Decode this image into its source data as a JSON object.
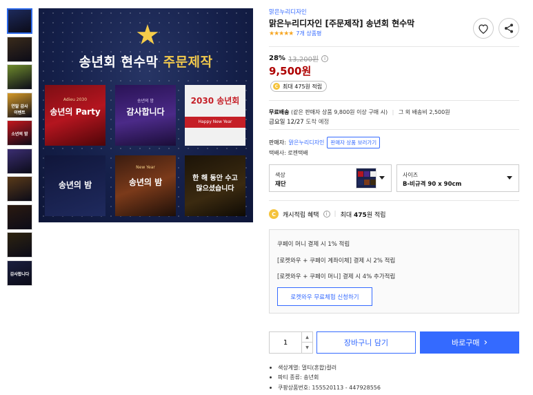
{
  "thumbnails": [
    {
      "label": "",
      "color": "#1d2a5c",
      "active": true
    },
    {
      "label": "",
      "color": "#3a2b1a"
    },
    {
      "label": "",
      "color": "#6e8a2c"
    },
    {
      "label": "연말 감사 이벤트",
      "color": "#d59a28"
    },
    {
      "label": "소년의 밤",
      "color": "#c4161c"
    },
    {
      "label": "",
      "color": "#3b2e72"
    },
    {
      "label": "",
      "color": "#5a3a18"
    },
    {
      "label": "",
      "color": "#2b1a10"
    },
    {
      "label": "",
      "color": "#2e2410"
    },
    {
      "label": "감사합니다",
      "color": "#1b1f3e"
    }
  ],
  "main_image": {
    "headline_a": "송년회 현수막",
    "headline_b": "주문제작",
    "tiles": [
      {
        "title": "송년의 Party",
        "sub": "Adieu 2030"
      },
      {
        "title": "감사합니다",
        "sub": "송년의 밤"
      },
      {
        "title": "2030 송년회",
        "sub": "Happy New Year"
      },
      {
        "title": "송년의 밤",
        "sub": ""
      },
      {
        "title": "송년의 밤",
        "sub": "New Year"
      },
      {
        "title": "한 해 동안 수고 많으셨습니다",
        "sub": ""
      }
    ]
  },
  "product": {
    "seller_link": "맑은누리디자인",
    "title": "맑은누리디자인 [주문제작] 송년회 현수막",
    "stars": "★★★★★",
    "review_count": "7개 상품평",
    "discount": "28%",
    "original_price": "13,200원",
    "sale_price": "9,500원",
    "cash_chip": "최대 475원 적립"
  },
  "shipping": {
    "free_label": "무료배송",
    "free_cond": "(같은 판매자 상품 9,800원 이상 구매 시)",
    "sep": "|",
    "other": "그 외 배송비 2,500원",
    "eta_date": "금요일 12/27",
    "eta_label": "도착 예정"
  },
  "seller": {
    "label": "판매자:",
    "name": "맑은누리디자인",
    "other_products": "판매자 상품 보러가기",
    "courier": "택배사: 로젠택배"
  },
  "options": {
    "color_key": "색상",
    "color_value": "재단",
    "size_key": "사이즈",
    "size_value": "B-비규격 90 x 90cm"
  },
  "cash": {
    "label": "캐시적립 혜택",
    "sep": "|",
    "value_pre": "최대 ",
    "value_num": "475",
    "value_post": "원 적립",
    "coin": "C",
    "lines": [
      "쿠페이 머니 결제 시 1% 적립",
      "[로켓와우 + 쿠페이 계좌이체] 결제 시 2% 적립",
      "[로켓와우 + 쿠페이 머니] 결제 시 4% 추가적립"
    ],
    "trial_button": "로켓와우 무료체험 신청하기"
  },
  "purchase": {
    "quantity": "1",
    "cart": "장바구니 담기",
    "buy": "바로구매",
    "buy_arrow": "›"
  },
  "specs": [
    "색상계열: 멀티(혼합)컬러",
    "파티 종류: 송년회",
    "쿠팡상품번호: 155520113 - 447928556"
  ],
  "colors": {
    "accent": "#346aff",
    "price_red": "#ae0000",
    "star": "#f6a623",
    "coin": "#f5c33b"
  }
}
